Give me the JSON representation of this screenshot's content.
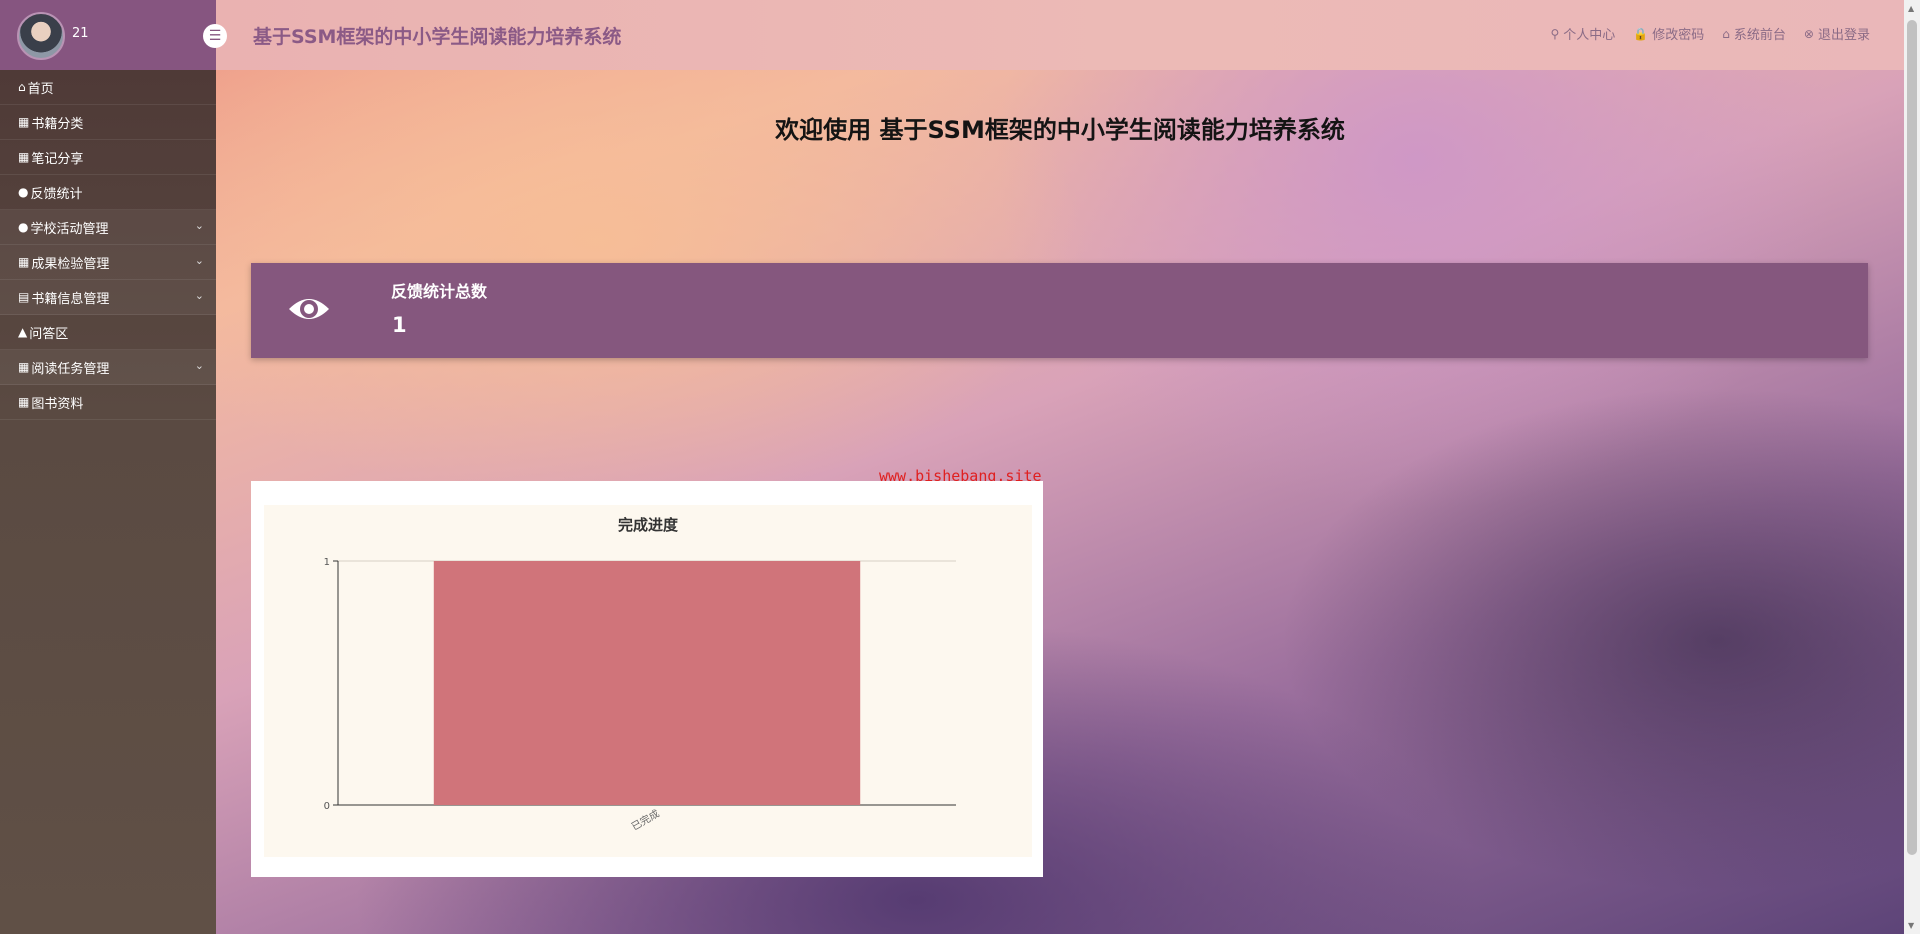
{
  "header": {
    "username": "21",
    "title": "基于SSM框架的中小学生阅读能力培养系统",
    "links": [
      {
        "icon": "user-icon",
        "glyph": "⚲",
        "label": "个人中心"
      },
      {
        "icon": "lock-icon",
        "glyph": "🔒",
        "label": "修改密码"
      },
      {
        "icon": "home-icon",
        "glyph": "⌂",
        "label": "系统前台"
      },
      {
        "icon": "logout-icon",
        "glyph": "⊗",
        "label": "退出登录"
      }
    ]
  },
  "sidebar": {
    "items": [
      {
        "label": "首页",
        "glyph": "⌂",
        "has_submenu": false
      },
      {
        "label": "书籍分类",
        "glyph": "▦",
        "has_submenu": false
      },
      {
        "label": "笔记分享",
        "glyph": "▦",
        "has_submenu": false
      },
      {
        "label": "反馈统计",
        "glyph": "●",
        "has_submenu": false
      },
      {
        "label": "学校活动管理",
        "glyph": "●",
        "has_submenu": true
      },
      {
        "label": "成果检验管理",
        "glyph": "▦",
        "has_submenu": true
      },
      {
        "label": "书籍信息管理",
        "glyph": "▤",
        "has_submenu": true
      },
      {
        "label": "问答区",
        "glyph": "▲",
        "has_submenu": false
      },
      {
        "label": "阅读任务管理",
        "glyph": "▦",
        "has_submenu": true
      },
      {
        "label": "图书资料",
        "glyph": "▦",
        "has_submenu": false
      }
    ],
    "chevron": "⌄"
  },
  "main": {
    "welcome": "欢迎使用 基于SSM框架的中小学生阅读能力培养系统",
    "stat": {
      "label": "反馈统计总数",
      "value": "1"
    },
    "watermark": "www.bishebang.site"
  },
  "colors": {
    "accent": "#865580",
    "bar": "#d0747a"
  },
  "chart_data": {
    "type": "bar",
    "title": "完成进度",
    "categories": [
      "已完成"
    ],
    "values": [
      1
    ],
    "ylim": [
      0,
      1
    ],
    "yticks": [
      0,
      1
    ],
    "grid": false,
    "legend": false
  }
}
